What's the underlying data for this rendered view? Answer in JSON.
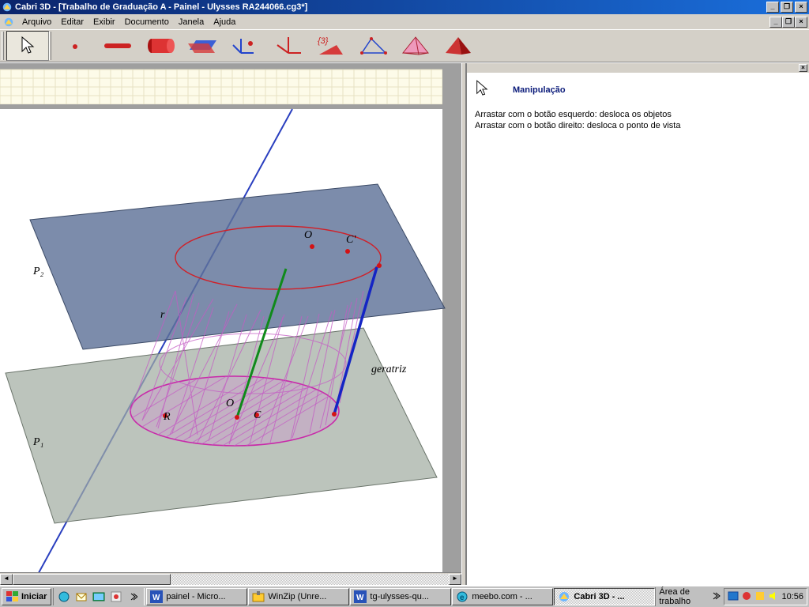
{
  "titlebar": {
    "app_name": "Cabri 3D",
    "doc_title": "[Trabalho de Graduação A - Painel - Ulysses RA244066.cg3*]",
    "full": "Cabri 3D - [Trabalho de Graduação A - Painel - Ulysses RA244066.cg3*]",
    "minimize": "_",
    "maximize": "❐",
    "close": "×"
  },
  "menu": {
    "arquivo": "Arquivo",
    "editar": "Editar",
    "exibir": "Exibir",
    "documento": "Documento",
    "janela": "Janela",
    "ajuda": "Ajuda"
  },
  "toolbar_icons": [
    {
      "name": "arrow-tool",
      "glyph": "cursor"
    },
    {
      "name": "point-tool",
      "glyph": "point"
    },
    {
      "name": "line-tool",
      "glyph": "segment"
    },
    {
      "name": "cylinder-tool",
      "glyph": "cylinder"
    },
    {
      "name": "plane-tool",
      "glyph": "plane"
    },
    {
      "name": "perpendicular-tool",
      "glyph": "perp"
    },
    {
      "name": "axes-tool",
      "glyph": "axes"
    },
    {
      "name": "transform-tool",
      "glyph": "brace",
      "label": "{3}"
    },
    {
      "name": "triangle-tool",
      "glyph": "triangle2d"
    },
    {
      "name": "tetrahedron-tool",
      "glyph": "tetra-wire"
    },
    {
      "name": "tetrahedron-solid-tool",
      "glyph": "tetra-solid"
    }
  ],
  "scene": {
    "labels": {
      "P1": "P₁",
      "P2": "P₂",
      "r": "r",
      "R": "R",
      "O_top": "O",
      "C_prime": "C'",
      "O_bottom": "O",
      "C_bottom": "C",
      "geratriz": "geratriz"
    },
    "colors": {
      "plane_top": "#5f7398",
      "plane_bottom": "#a2ada2",
      "line_r": "#2a3fbf",
      "circle_top": "#d02028",
      "circle_bottom": "#c82aa9",
      "cylinder_mesh": "#c45bc4",
      "axis_green": "#108a1b",
      "geratriz_blue": "#1425c4",
      "point": "#d31214"
    }
  },
  "help": {
    "title": "Manipulação",
    "line1": "Arrastar com o botão esquerdo: desloca os objetos",
    "line2": "Arrastar com o botão direito: desloca o ponto de vista"
  },
  "taskbar": {
    "start": "Iniciar",
    "items": [
      {
        "label": "painel - Micro...",
        "icon": "word"
      },
      {
        "label": "WinZip (Unre...",
        "icon": "winzip"
      },
      {
        "label": "tg-ulysses-qu...",
        "icon": "word"
      },
      {
        "label": "meebo.com - ...",
        "icon": "ie"
      },
      {
        "label": "Cabri 3D - ...",
        "icon": "cabri",
        "active": true
      }
    ],
    "desk_label": "Área de trabalho",
    "clock": "10:56"
  }
}
